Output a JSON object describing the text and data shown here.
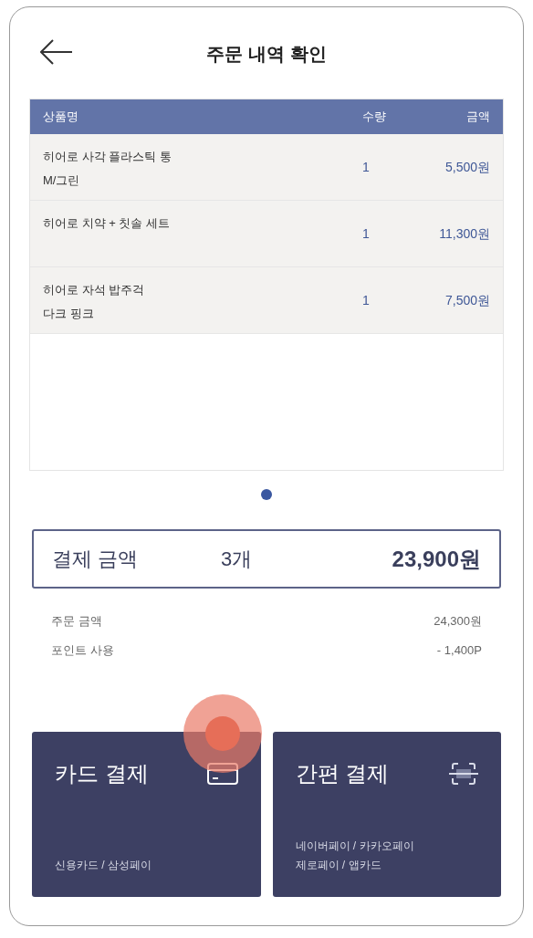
{
  "header": {
    "title": "주문 내역 확인"
  },
  "table": {
    "columns": [
      "상품명",
      "수량",
      "금액"
    ],
    "rows": [
      {
        "name": "히어로 사각 플라스틱 통",
        "option": "M/그린",
        "qty": "1",
        "price": "5,500원"
      },
      {
        "name": "히어로 치약 + 칫솔 세트",
        "qty": "1",
        "price": "11,300원"
      },
      {
        "name": "히어로 자석 밥주걱",
        "option": "다크 핑크",
        "qty": "1",
        "price": "7,500원"
      }
    ]
  },
  "pager": [
    {
      "selected": true
    }
  ],
  "summary": {
    "label": "결제 금액",
    "count": "3개",
    "total": "23,900원"
  },
  "details": [
    {
      "label": "주문 금액",
      "value": "24,300원"
    },
    {
      "label": "포인트 사용",
      "value": "- 1,400P"
    }
  ],
  "payments": [
    {
      "kind": "card",
      "title": "카드 결제",
      "lines": [
        "신용카드 / 삼성페이"
      ]
    },
    {
      "kind": "scan",
      "title": "간편 결제",
      "lines": [
        "네이버페이 / 카카오페이",
        "제로페이 / 앱카드"
      ]
    }
  ]
}
